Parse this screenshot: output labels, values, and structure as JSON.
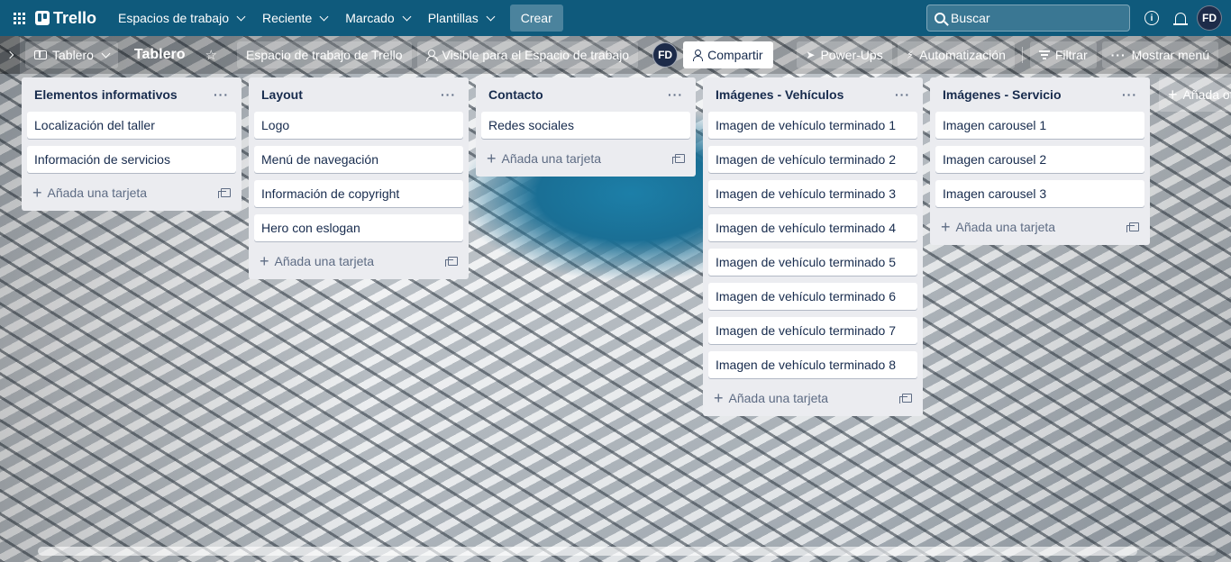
{
  "topnav": {
    "logo_text": "Trello",
    "menus": [
      {
        "label": "Espacios de trabajo"
      },
      {
        "label": "Reciente"
      },
      {
        "label": "Marcado"
      },
      {
        "label": "Plantillas"
      }
    ],
    "create_label": "Crear",
    "search_placeholder": "Buscar",
    "info_glyph": "i",
    "avatar_initials": "FD"
  },
  "boardbar": {
    "view_label": "Tablero",
    "board_title": "Tablero",
    "star_glyph": "☆",
    "workspace_label": "Espacio de trabajo de Trello",
    "visibility_label": "Visible para el Espacio de trabajo",
    "member_initials": "FD",
    "share_label": "Compartir",
    "powerups_label": "Power-Ups",
    "automation_label": "Automatización",
    "filter_label": "Filtrar",
    "menu_label": "Mostrar menú",
    "menu_glyph": "···"
  },
  "lists": [
    {
      "title": "Elementos informativos",
      "cards": [
        "Localización del taller",
        "Información de servicios"
      ],
      "add_label": "Añada una tarjeta"
    },
    {
      "title": "Layout",
      "cards": [
        "Logo",
        "Menú de navegación",
        "Información de copyright",
        "Hero con eslogan"
      ],
      "add_label": "Añada una tarjeta"
    },
    {
      "title": "Contacto",
      "cards": [
        "Redes sociales"
      ],
      "add_label": "Añada una tarjeta"
    },
    {
      "title": "Imágenes - Vehículos",
      "cards": [
        "Imagen de vehículo terminado 1",
        "Imagen de vehículo terminado 2",
        "Imagen de vehículo terminado 3",
        "Imagen de vehículo terminado 4",
        "Imagen de vehículo terminado 5",
        "Imagen de vehículo terminado 6",
        "Imagen de vehículo terminado 7",
        "Imagen de vehículo terminado 8"
      ],
      "add_label": "Añada una tarjeta"
    },
    {
      "title": "Imágenes - Servicio",
      "cards": [
        "Imagen carousel 1",
        "Imagen carousel 2",
        "Imagen carousel 3"
      ],
      "add_label": "Añada una tarjeta"
    }
  ],
  "list_menu_glyph": "···",
  "add_glyph": "+",
  "add_list_label": "Añada otra lista",
  "colors": {
    "topnav": "#0f5a7c",
    "list_bg": "#ebecf0",
    "card_bg": "#ffffff",
    "text": "#172b4d"
  }
}
